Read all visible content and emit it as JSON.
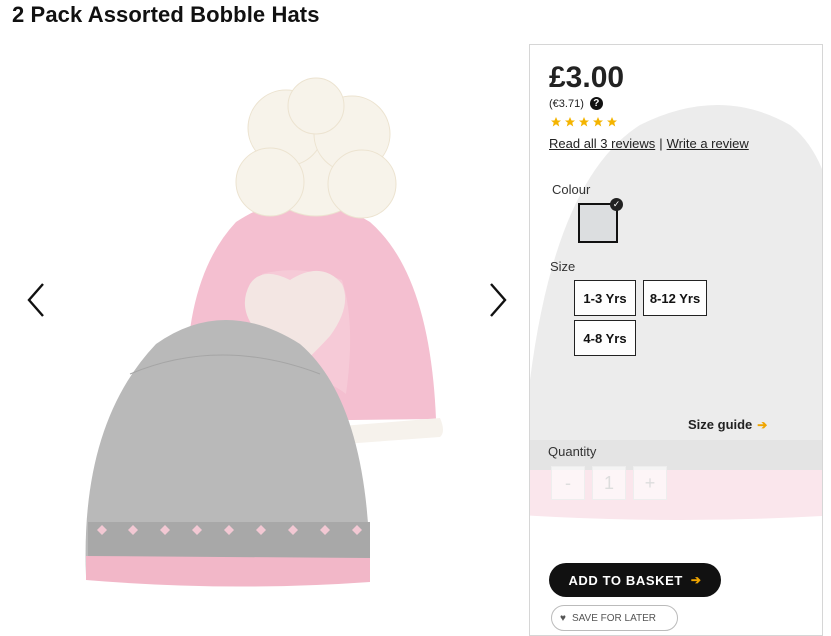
{
  "product": {
    "title": "2 Pack Assorted Bobble Hats"
  },
  "pricing": {
    "price": "£3.00",
    "alt_price": "(€3.71)",
    "help_icon": "question-icon",
    "rating": 5,
    "rating_max": 5
  },
  "reviews": {
    "read_all": "Read all 3 reviews",
    "separator": "|",
    "write": "Write a review"
  },
  "colour": {
    "label": "Colour",
    "selected_swatch": "#dcdee0",
    "selected_icon": "check-icon"
  },
  "size": {
    "label": "Size",
    "options": [
      "1-3 Yrs",
      "8-12 Yrs",
      "4-8 Yrs"
    ]
  },
  "size_guide": {
    "label": "Size guide",
    "icon": "arrow-right-icon"
  },
  "quantity": {
    "label": "Quantity",
    "minus": "-",
    "value": "1",
    "plus": "+"
  },
  "actions": {
    "add_to_basket": "ADD TO BASKET",
    "save_for_later": "SAVE FOR LATER",
    "save_icon": "heart-icon"
  },
  "gallery": {
    "prev_icon": "chevron-left-icon",
    "next_icon": "chevron-right-icon"
  },
  "colors": {
    "accent": "#f0a500",
    "button": "#111111",
    "star": "#f4b400"
  }
}
